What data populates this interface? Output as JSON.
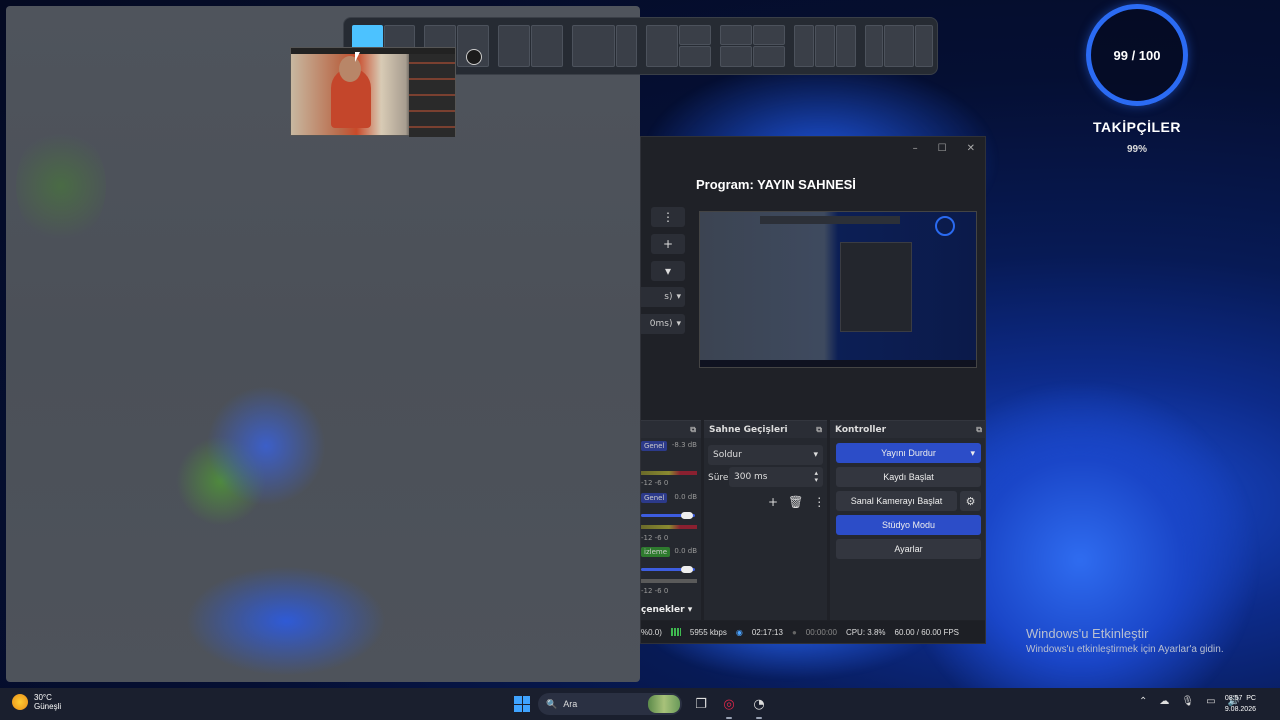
{
  "snap_layouts": {
    "groups": 9
  },
  "obs": {
    "window_controls": {
      "minimize": "–",
      "maximize": "☐",
      "close": "✕"
    },
    "program_title": "Program: YAYIN SAHNESİ",
    "left_fragments": {
      "f1": "s)",
      "f2": "0ms)"
    },
    "audio": {
      "header": "",
      "ch1_tag": "Genel",
      "ch1_db": "-8.3 dB",
      "ch2_tag": "Genel",
      "ch2_db": "0.0 dB",
      "ch3_tag": "izleme",
      "ch3_db": "0.0 dB",
      "scale": "-12  -6  0",
      "options": "çenekler"
    },
    "transitions": {
      "header": "Sahne Geçişleri",
      "selected": "Soldur",
      "duration_label": "Süre",
      "duration_value": "300 ms"
    },
    "controls": {
      "header": "Kontroller",
      "stop_stream": "Yayını Durdur",
      "start_recording": "Kaydı Başlat",
      "start_virtual_camera": "Sanal Kamerayı Başlat",
      "studio_mode": "Stüdyo Modu",
      "settings": "Ayarlar"
    },
    "status": {
      "frag": "%0.0)",
      "bitrate": "5955 kbps",
      "stream_time": "02:17:13",
      "rec_time": "00:00:00",
      "cpu": "CPU: 3.8%",
      "fps": "60.00 / 60.00 FPS"
    }
  },
  "followers": {
    "count": "99 / 100",
    "title": "TAKİPÇİLER",
    "percent": "99%",
    "ring_color": "#2b6bf3"
  },
  "activation": {
    "title": "Windows'u Etkinleştir",
    "subtitle": "Windows'u etkinleştirmek için Ayarlar'a gidin."
  },
  "taskbar": {
    "weather_temp": "30°C",
    "weather_desc": "Güneşli",
    "search_placeholder": "Ara",
    "time": "08:57",
    "date": "9.08.2026",
    "lang": "PC"
  }
}
